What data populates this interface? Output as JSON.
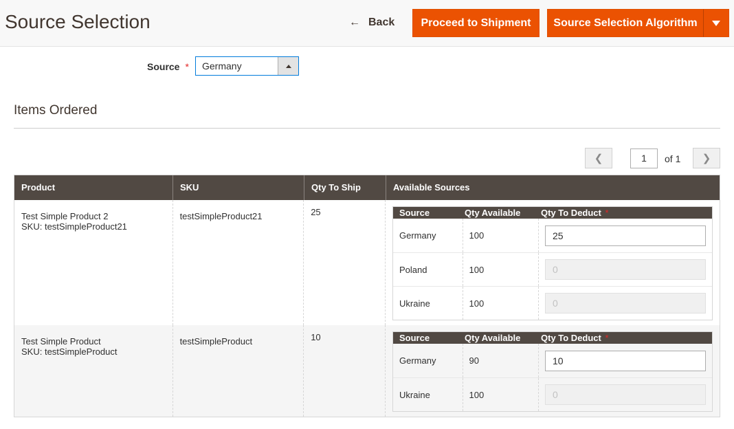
{
  "header": {
    "title": "Source Selection",
    "back_label": "Back",
    "proceed_label": "Proceed to Shipment",
    "algorithm_label": "Source Selection Algorithm"
  },
  "source_field": {
    "label": "Source",
    "required_mark": "*",
    "value": "Germany"
  },
  "section": {
    "title": "Items Ordered"
  },
  "pager": {
    "current_page": "1",
    "of_label": "of 1"
  },
  "grid": {
    "columns": [
      "Product",
      "SKU",
      "Qty To Ship",
      "Available Sources"
    ],
    "source_columns": [
      "Source",
      "Qty Available",
      "Qty To Deduct"
    ],
    "required_mark": "*",
    "rows": [
      {
        "product_name": "Test Simple Product 2",
        "product_sku_line": "SKU: testSimpleProduct21",
        "sku": "testSimpleProduct21",
        "qty_to_ship": "25",
        "sources": [
          {
            "source": "Germany",
            "qty_available": "100",
            "qty_to_deduct": "25",
            "enabled": true
          },
          {
            "source": "Poland",
            "qty_available": "100",
            "qty_to_deduct": "0",
            "enabled": false
          },
          {
            "source": "Ukraine",
            "qty_available": "100",
            "qty_to_deduct": "0",
            "enabled": false
          }
        ]
      },
      {
        "product_name": "Test Simple Product",
        "product_sku_line": "SKU: testSimpleProduct",
        "sku": "testSimpleProduct",
        "qty_to_ship": "10",
        "sources": [
          {
            "source": "Germany",
            "qty_available": "90",
            "qty_to_deduct": "10",
            "enabled": true
          },
          {
            "source": "Ukraine",
            "qty_available": "100",
            "qty_to_deduct": "0",
            "enabled": false
          }
        ]
      }
    ]
  },
  "colors": {
    "accent": "#eb5202",
    "header_dark": "#514943",
    "title_text": "#41362f"
  }
}
